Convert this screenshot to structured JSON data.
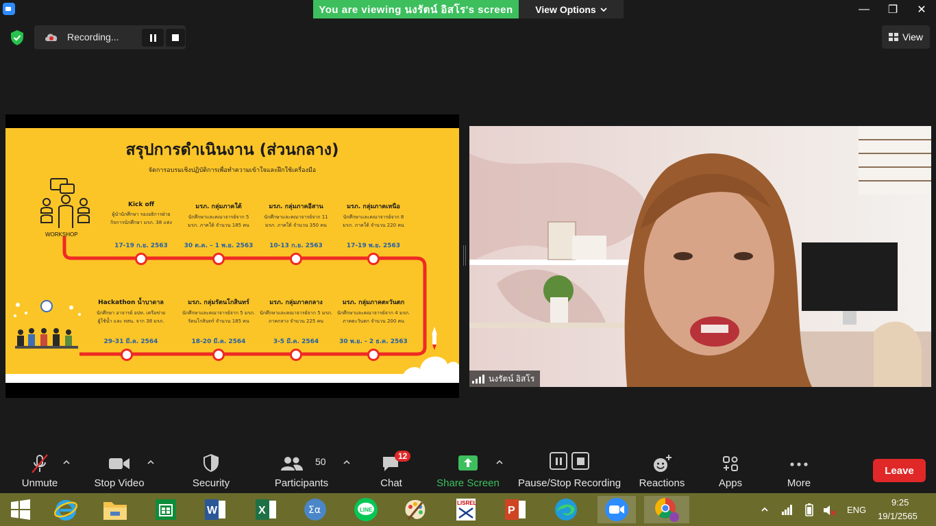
{
  "titlebar": {
    "viewing_text": "You are viewing นงรัตน์ อิสโร's screen",
    "view_options_label": "View Options",
    "minimize": "—",
    "restore": "❐",
    "close": "✕"
  },
  "recording": {
    "label": "Recording..."
  },
  "view_button": {
    "label": "View"
  },
  "slide": {
    "title": "สรุปการดำเนินงาน (ส่วนกลาง)",
    "subtitle": "จัดการอบรมเชิงปฏิบัติการเพื่อทำความเข้าใจและฝึกใช้เครื่องมือ",
    "workshop_label": "WORKSHOP",
    "top_stages": [
      {
        "title": "Kick off",
        "desc1": "ผู้นำนักศึกษา รองอธิการฝ่าย",
        "desc2": "กิจการนักศึกษา มรภ. 38 แห่ง",
        "date": "17-19 ก.ย. 2563"
      },
      {
        "title": "มรภ. กลุ่มภาคใต้",
        "desc1": "นักศึกษาและคณาจารย์จาก 5",
        "desc2": "มรภ. ภาคใต้ จำนวน 185 คน",
        "date": "30 ต.ค. – 1 พ.ย. 2563"
      },
      {
        "title": "มรภ. กลุ่มภาคอีสาน",
        "desc1": "นักศึกษาและคณาจารย์จาก 11",
        "desc2": "มรภ. ภาคใต้ จำนวน 350 คน",
        "date": "10-13 ก.ย. 2563"
      },
      {
        "title": "มรภ. กลุ่มภาคเหนือ",
        "desc1": "นักศึกษาและคณาจารย์จาก 8",
        "desc2": "มรภ. ภาคใต้ จำนวน 220 คน",
        "date": "17-19 พ.ย. 2563"
      }
    ],
    "bottom_stages": [
      {
        "title": "Hackathon น้ำบาดาล",
        "desc1": "นักศึกษา อาจารย์ อปท. เครือข่าย",
        "desc2": "ผู้ใช้น้ำ และ ทสน. จาก 38 มรภ.",
        "date": "29-31 มี.ค. 2564"
      },
      {
        "title": "มรภ. กลุ่มรัตนโกสินทร์",
        "desc1": "นักศึกษาและคณาจารย์จาก 5 มรภ.",
        "desc2": "รัตนโกสินทร์ จำนวน 185 คน",
        "date": "18-20 มี.ค. 2564"
      },
      {
        "title": "มรภ. กลุ่มภาคกลาง",
        "desc1": "นักศึกษาและคณาจารย์จาก 5 มรภ.",
        "desc2": "ภาคกลาง จำนวน 225 คน",
        "date": "3-5 มี.ค. 2564"
      },
      {
        "title": "มรภ. กลุ่มภาคตะวันตก",
        "desc1": "นักศึกษาและคณาจารย์จาก 4 มรภ.",
        "desc2": "ภาคตะวันตก จำนวน 200 คน",
        "date": "30 พ.ย. - 2 ธ.ค. 2563"
      }
    ]
  },
  "camera": {
    "name": "นงรัตน์ อิสโร"
  },
  "toolbar": {
    "unmute": "Unmute",
    "stop_video": "Stop Video",
    "security": "Security",
    "participants": "Participants",
    "participants_count": "50",
    "chat": "Chat",
    "chat_badge": "12",
    "share_screen": "Share Screen",
    "pause_stop_recording": "Pause/Stop Recording",
    "reactions": "Reactions",
    "apps": "Apps",
    "more": "More",
    "leave": "Leave"
  },
  "taskbar": {
    "lang": "ENG",
    "time": "9:25",
    "date": "19/1/2565"
  },
  "colors": {
    "share_green": "#3dbf5e",
    "leave_red": "#e02828",
    "slide_yellow": "#fcc527",
    "timeline_red": "#ee2a24",
    "taskbar": "#6b6b2c"
  }
}
